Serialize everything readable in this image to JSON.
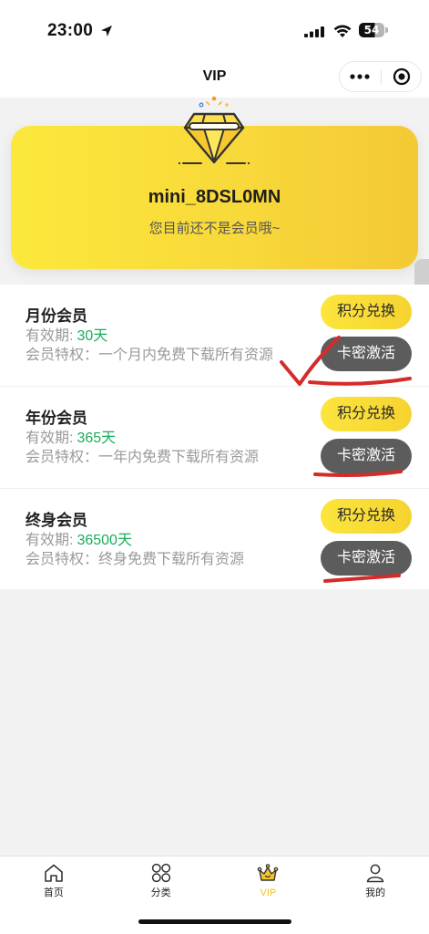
{
  "status_bar": {
    "time": "23:00",
    "battery_level": "54",
    "icons": [
      "location-arrow-icon",
      "cellular-signal-icon",
      "wifi-icon",
      "battery-icon"
    ]
  },
  "nav_bar": {
    "title": "VIP",
    "capsule_icons": [
      "more-dots-icon",
      "target-circle-icon"
    ]
  },
  "vip_card": {
    "icon": "diamond-icon",
    "username": "mini_8DSL0MN",
    "status_text": "您目前还不是会员哦~"
  },
  "plans": [
    {
      "name": "月份会员",
      "validity_label": "有效期:",
      "validity_value": "30天",
      "privilege_label": "会员特权：",
      "privilege_text": "一个月内免费下载所有资源",
      "redeem_button": "积分兑换",
      "activate_button": "卡密激活"
    },
    {
      "name": "年份会员",
      "validity_label": "有效期:",
      "validity_value": "365天",
      "privilege_label": "会员特权：",
      "privilege_text": "一年内免费下载所有资源",
      "redeem_button": "积分兑换",
      "activate_button": "卡密激活"
    },
    {
      "name": "终身会员",
      "validity_label": "有效期:",
      "validity_value": "36500天",
      "privilege_label": "会员特权：",
      "privilege_text": "终身免费下载所有资源",
      "redeem_button": "积分兑换",
      "activate_button": "卡密激活"
    }
  ],
  "tab_bar": {
    "items": [
      {
        "label": "首页",
        "icon": "home-icon",
        "active": false
      },
      {
        "label": "分类",
        "icon": "category-grid-icon",
        "active": false
      },
      {
        "label": "VIP",
        "icon": "crown-icon",
        "active": true
      },
      {
        "label": "我的",
        "icon": "profile-icon",
        "active": false
      }
    ]
  },
  "colors": {
    "page_background": "#f2f2f2",
    "card_gradient_start": "#fce83c",
    "card_gradient_end": "#f3c934",
    "redeem_button": "#f6d330",
    "activate_button": "#5c5c5c",
    "validity_value": "#1aad5b",
    "tab_active": "#f2c12e",
    "annotation": "#d42b2b"
  }
}
